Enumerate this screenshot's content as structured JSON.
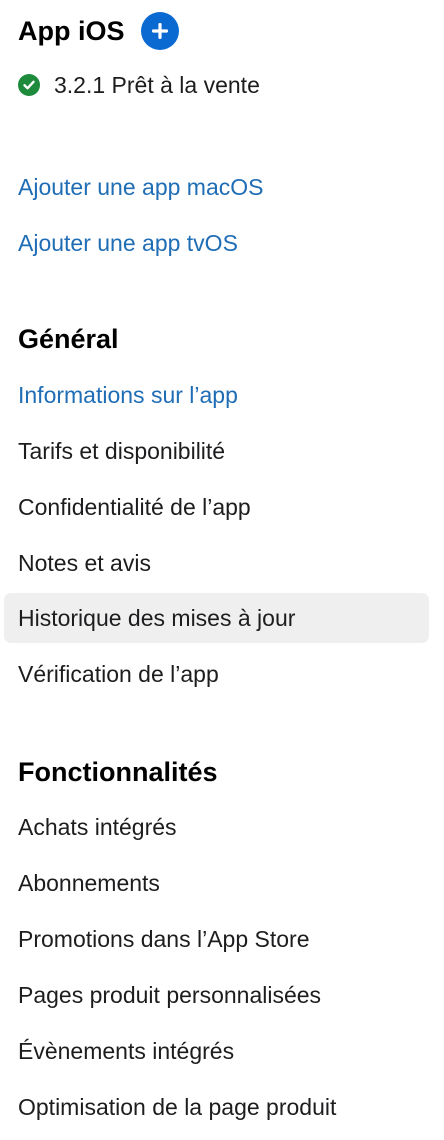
{
  "app_section": {
    "title": "App iOS",
    "add_icon": "plus-circle-icon",
    "status_icon": "check-circle-icon",
    "status_color": "#1e8a3c",
    "version_status": "3.2.1 Prêt à la vente"
  },
  "platform_links": {
    "add_macos": "Ajouter une app macOS",
    "add_tvos": "Ajouter une app tvOS"
  },
  "general": {
    "title": "Général",
    "items": [
      {
        "label": "Informations sur l’app"
      },
      {
        "label": "Tarifs et disponibilité"
      },
      {
        "label": "Confidentialité de l’app"
      },
      {
        "label": "Notes et avis"
      },
      {
        "label": "Historique des mises à jour"
      },
      {
        "label": "Vérification de l’app"
      }
    ]
  },
  "features": {
    "title": "Fonctionnalités",
    "items": [
      {
        "label": "Achats intégrés"
      },
      {
        "label": "Abonnements"
      },
      {
        "label": "Promotions dans l’App Store"
      },
      {
        "label": "Pages produit personnalisées"
      },
      {
        "label": "Évènements intégrés"
      },
      {
        "label": "Optimisation de la page produit"
      }
    ]
  },
  "colors": {
    "link": "#1f6db5",
    "accent_button": "#0b6ad1",
    "selected_background": "#efefef"
  }
}
